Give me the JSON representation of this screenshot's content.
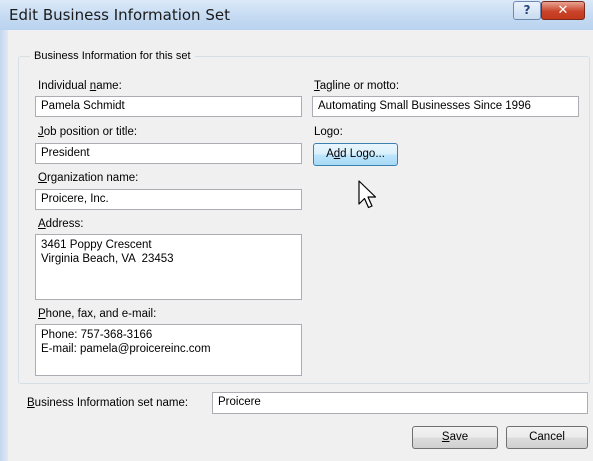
{
  "window": {
    "title": "Edit Business Information Set",
    "help_glyph": "?",
    "close_glyph": "✕"
  },
  "group": {
    "legend": "Business Information for this set"
  },
  "fields": {
    "individual_name": {
      "label_pre": "Individual ",
      "label_key": "n",
      "label_post": "ame:",
      "value": "Pamela Schmidt"
    },
    "job_title": {
      "label_pre": "",
      "label_key": "J",
      "label_post": "ob position or title:",
      "value": "President"
    },
    "organization": {
      "label_pre": "",
      "label_key": "O",
      "label_post": "rganization name:",
      "value": "Proicere, Inc."
    },
    "address": {
      "label_pre": "",
      "label_key": "A",
      "label_post": "ddress:",
      "value": "3461 Poppy Crescent\nVirginia Beach, VA  23453"
    },
    "phone": {
      "label_pre": "",
      "label_key": "P",
      "label_post": "hone, fax, and e-mail:",
      "value": "Phone: 757-368-3166\nE-mail: pamela@proicereinc.com"
    },
    "tagline": {
      "label_pre": "",
      "label_key": "T",
      "label_post": "agline or motto:",
      "value": "Automating Small Businesses Since 1996"
    },
    "logo": {
      "label": "Logo:",
      "button_pre": "A",
      "button_key": "d",
      "button_post": "d Logo..."
    }
  },
  "set_name": {
    "label_pre": "",
    "label_key": "B",
    "label_post": "usiness Information set name:",
    "value": "Proicere"
  },
  "buttons": {
    "save_key": "S",
    "save_post": "ave",
    "cancel": "Cancel"
  }
}
